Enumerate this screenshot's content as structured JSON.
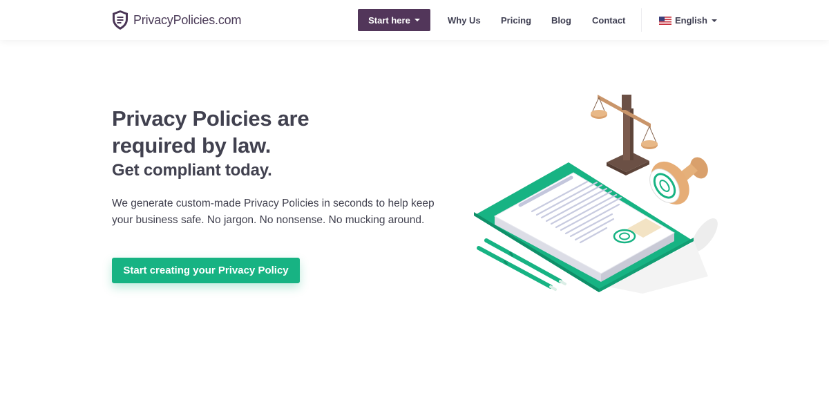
{
  "brand": {
    "name": "PrivacyPolicies",
    "domain": ".com"
  },
  "nav": {
    "start_label": "Start here",
    "links": [
      {
        "label": "Why Us"
      },
      {
        "label": "Pricing"
      },
      {
        "label": "Blog"
      },
      {
        "label": "Contact"
      }
    ],
    "language": "English"
  },
  "hero": {
    "title_line1": "Privacy Policies are",
    "title_line2": "required by law.",
    "subtitle": "Get compliant today.",
    "description_line1": "We generate custom-made Privacy Policies in seconds to help keep",
    "description_line2": "your business safe. No jargon. No nonsense. No mucking around.",
    "cta_label": "Start creating your Privacy Policy"
  },
  "colors": {
    "brand_purple": "#52365a",
    "accent_green": "#17b383",
    "text": "#41414f"
  },
  "icons": [
    "shield-logo-icon",
    "chevron-down-icon",
    "us-flag-icon"
  ]
}
